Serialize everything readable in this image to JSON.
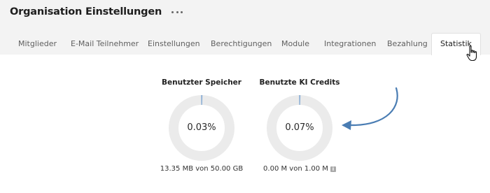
{
  "header": {
    "title": "Organisation Einstellungen",
    "more_icon": "more-horizontal-icon"
  },
  "tabs": [
    {
      "label": "Mitglieder",
      "active": false
    },
    {
      "label": "E-Mail Teilnehmer",
      "active": false
    },
    {
      "label": "Einstellungen",
      "active": false
    },
    {
      "label": "Berechtigungen",
      "active": false
    },
    {
      "label": "Module",
      "active": false
    },
    {
      "label": "Integrationen",
      "active": false
    },
    {
      "label": "Bezahlung",
      "active": false
    },
    {
      "label": "Statistik",
      "active": true
    }
  ],
  "stats": {
    "storage": {
      "label": "Benutzter Speicher",
      "percent_text": "0.03%",
      "fraction": 0.0003,
      "detail": "13.35 MB von 50.00 GB"
    },
    "ai_credits": {
      "label": "Benutzte KI Credits",
      "percent_text": "0.07%",
      "fraction": 0.0007,
      "detail": "0.00 M von 1.00 M",
      "info_icon": "info-icon"
    }
  },
  "colors": {
    "ring_track": "#ebebeb",
    "ring_fill": "#8fb1d6",
    "annotation_arrow": "#4a7db3",
    "header_bg": "#f3f3f3"
  }
}
